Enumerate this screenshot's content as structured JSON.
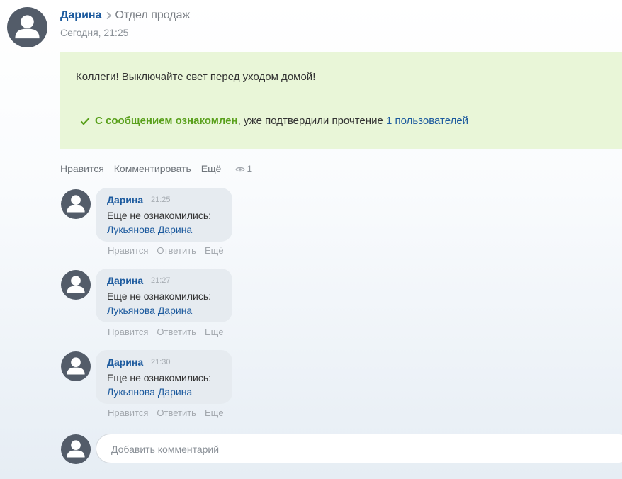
{
  "post": {
    "author": "Дарина",
    "department": "Отдел продаж",
    "time": "Сегодня, 21:25",
    "message": "Коллеги! Выключайте свет перед уходом домой!",
    "confirm_label": "С сообщением ознакомлен",
    "confirm_comma": ",",
    "confirm_text": " уже подтвердили прочтение ",
    "confirm_link": "1 пользователей",
    "actions": {
      "like": "Нравится",
      "comment": "Комментировать",
      "more": "Ещё",
      "views": "1"
    }
  },
  "comments": [
    {
      "author": "Дарина",
      "time": "21:25",
      "text": "Еще не ознакомились:",
      "link": "Лукьянова Дарина",
      "actions": {
        "like": "Нравится",
        "reply": "Ответить",
        "more": "Ещё"
      }
    },
    {
      "author": "Дарина",
      "time": "21:27",
      "text": "Еще не ознакомились:",
      "link": "Лукьянова Дарина",
      "actions": {
        "like": "Нравится",
        "reply": "Ответить",
        "more": "Ещё"
      }
    },
    {
      "author": "Дарина",
      "time": "21:30",
      "text": "Еще не ознакомились:",
      "link": "Лукьянова Дарина",
      "actions": {
        "like": "Нравится",
        "reply": "Ответить",
        "more": "Ещё"
      }
    }
  ],
  "add_comment": {
    "placeholder": "Добавить комментарий"
  },
  "icons": {
    "avatar": "user-silhouette-icon",
    "chevron": "chevron-right-icon",
    "check": "checkmark-icon",
    "views": "eye-icon"
  },
  "colors": {
    "link": "#1c5a9e",
    "confirm_green": "#59a01b",
    "message_bg": "#e9f6d8",
    "bubble_bg": "#e6ebf0",
    "avatar_bg": "#535c69"
  }
}
